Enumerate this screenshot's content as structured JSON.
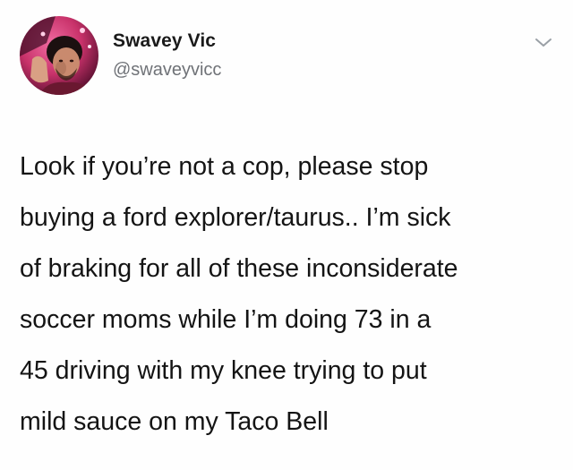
{
  "author": {
    "display_name": "Swavey Vic",
    "handle": "@swaveyvicc",
    "avatar_icon": "profile-photo"
  },
  "menu": {
    "icon": "chevron-down-icon"
  },
  "tweet": {
    "lines": [
      "Look if you’re not a cop, please stop",
      "buying a ford explorer/taurus.. I’m sick",
      "of braking for all of these inconsiderate",
      "soccer moms while I’m doing 73 in a",
      "45 driving with my knee trying to put",
      "mild sauce on my Taco Bell"
    ]
  },
  "colors": {
    "name": "#1a1a1a",
    "handle": "#6f7277",
    "text": "#141414"
  }
}
